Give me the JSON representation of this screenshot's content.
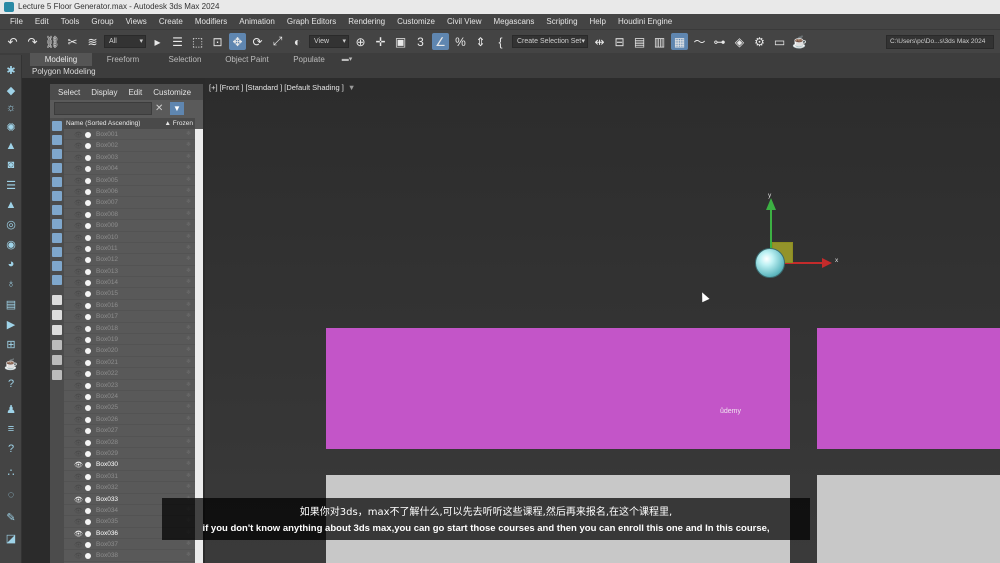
{
  "window": {
    "title": "Lecture 5 Floor Generator.max - Autodesk 3ds Max 2024"
  },
  "menu": [
    "File",
    "Edit",
    "Tools",
    "Group",
    "Views",
    "Create",
    "Modifiers",
    "Animation",
    "Graph Editors",
    "Rendering",
    "Customize",
    "Civil View",
    "Megascans",
    "Scripting",
    "Help",
    "Houdini Engine"
  ],
  "toolbar": {
    "selection_filter": "All",
    "ref_coord": "View",
    "selection_set_placeholder": "Create Selection Set",
    "project_path": "C:\\Users\\pc\\Do...s\\3ds Max 2024"
  },
  "ribbon": {
    "tabs": [
      "Modeling",
      "Freeform",
      "Selection",
      "Object Paint",
      "Populate"
    ],
    "active_tab": "Modeling",
    "panel_label": "Polygon Modeling"
  },
  "scene_explorer": {
    "tabs": [
      "Select",
      "Display",
      "Edit",
      "Customize"
    ],
    "column_name": "Name (Sorted Ascending)",
    "column_frozen": "▲ Frozen",
    "objects": [
      {
        "name": "Box001",
        "visible": false
      },
      {
        "name": "Box002",
        "visible": false
      },
      {
        "name": "Box003",
        "visible": false
      },
      {
        "name": "Box004",
        "visible": false
      },
      {
        "name": "Box005",
        "visible": false
      },
      {
        "name": "Box006",
        "visible": false
      },
      {
        "name": "Box007",
        "visible": false
      },
      {
        "name": "Box008",
        "visible": false
      },
      {
        "name": "Box009",
        "visible": false
      },
      {
        "name": "Box010",
        "visible": false
      },
      {
        "name": "Box011",
        "visible": false
      },
      {
        "name": "Box012",
        "visible": false
      },
      {
        "name": "Box013",
        "visible": false
      },
      {
        "name": "Box014",
        "visible": false
      },
      {
        "name": "Box015",
        "visible": false
      },
      {
        "name": "Box016",
        "visible": false
      },
      {
        "name": "Box017",
        "visible": false
      },
      {
        "name": "Box018",
        "visible": false
      },
      {
        "name": "Box019",
        "visible": false
      },
      {
        "name": "Box020",
        "visible": false
      },
      {
        "name": "Box021",
        "visible": false
      },
      {
        "name": "Box022",
        "visible": false
      },
      {
        "name": "Box023",
        "visible": false
      },
      {
        "name": "Box024",
        "visible": false
      },
      {
        "name": "Box025",
        "visible": false
      },
      {
        "name": "Box026",
        "visible": false
      },
      {
        "name": "Box027",
        "visible": false
      },
      {
        "name": "Box028",
        "visible": false
      },
      {
        "name": "Box029",
        "visible": false
      },
      {
        "name": "Box030",
        "visible": true
      },
      {
        "name": "Box031",
        "visible": false
      },
      {
        "name": "Box032",
        "visible": false
      },
      {
        "name": "Box033",
        "visible": true
      },
      {
        "name": "Box034",
        "visible": false
      },
      {
        "name": "Box035",
        "visible": false
      },
      {
        "name": "Box036",
        "visible": true
      },
      {
        "name": "Box037",
        "visible": false
      },
      {
        "name": "Box038",
        "visible": false
      }
    ]
  },
  "viewport": {
    "label": "[+] [Front ] [Standard ] [Default Shading ]",
    "gizmo_y_label": "y",
    "gizmo_x_label": "x",
    "watermark": "ûdemy",
    "box_color": "#c355c8",
    "floor_color": "#c8c8c8"
  },
  "subtitles": {
    "zh": "如果你对3ds，max不了解什么,可以先去听听这些课程,然后再来报名,在这个课程里,",
    "en": "if you don't know anything about 3ds max,you can go start those courses and then you can enroll this one and In this course,"
  },
  "icons": {
    "undo": "undo-icon",
    "redo": "redo-icon",
    "link": "link-icon",
    "unlink": "unlink-icon",
    "select": "select-icon",
    "move": "move-icon",
    "rotate": "rotate-icon",
    "scale": "scale-icon",
    "snap": "snap-icon",
    "layers": "layers-icon",
    "render": "render-icon",
    "teapot": "teapot-icon"
  }
}
